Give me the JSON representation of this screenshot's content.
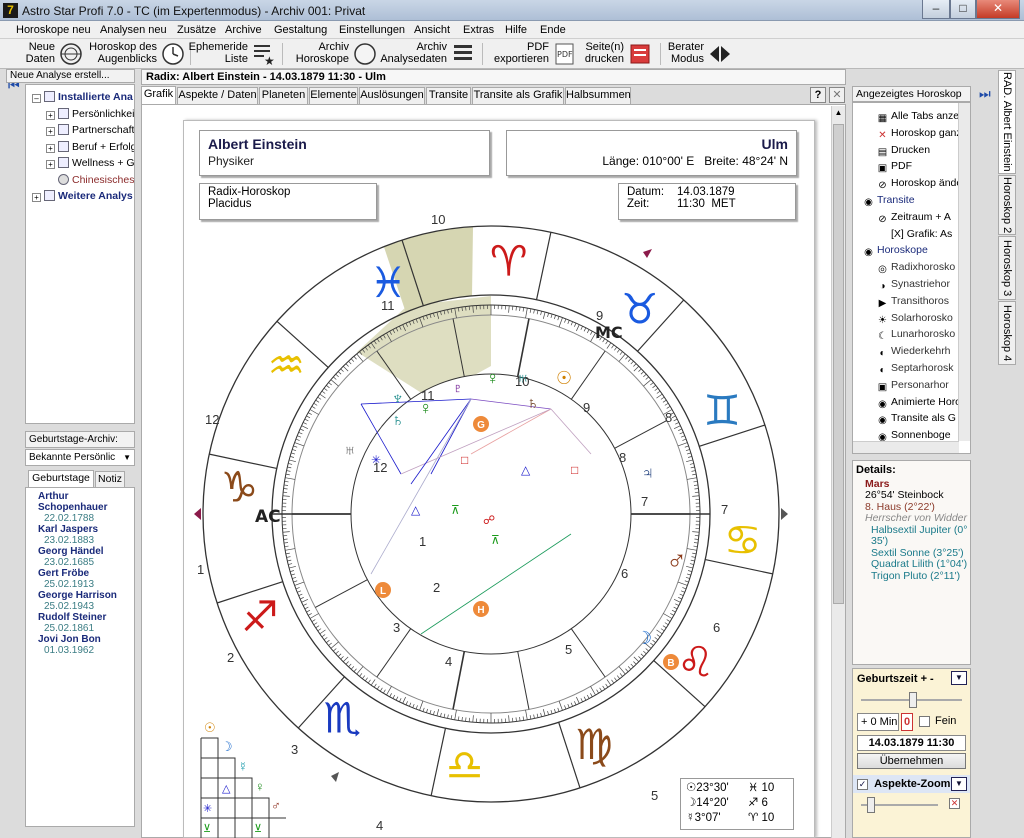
{
  "window": {
    "title": "Astro Star Profi 7.0 - TC (im Expertenmodus) - Archiv 001: Privat",
    "app_icon": "7",
    "minimize": "–",
    "maximize": "□",
    "close": "✕"
  },
  "menu": [
    "Horoskope neu",
    "Analysen neu",
    "Zusätze",
    "Archive",
    "Gestaltung",
    "Einstellungen",
    "Ansicht",
    "Extras",
    "Hilfe",
    "Ende"
  ],
  "toolbar": {
    "neue_daten": "Neue\nDaten",
    "horoskop_augenblick": "Horoskop des\nAugenblicks",
    "ephemeride": "Ephemeride\nListe",
    "archiv_horoskope": "Archiv\nHoroskope",
    "archiv_analysedaten": "Archiv\nAnalysedaten",
    "pdf": "PDF\nexportieren",
    "drucken": "Seite(n)\ndrucken",
    "berater": "Berater\nModus"
  },
  "left": {
    "header": "Neue Analyse erstell...",
    "tree": [
      {
        "label": "Installierte Ana",
        "bold": true,
        "pm": "–"
      },
      {
        "label": "Persönlichkeit",
        "pm": "+"
      },
      {
        "label": "Partnerschaft",
        "pm": "+"
      },
      {
        "label": "Beruf + Erfolg",
        "pm": "+"
      },
      {
        "label": "Wellness + Ge",
        "pm": "+"
      },
      {
        "label": "Chinesisches",
        "pm": ""
      },
      {
        "label": "Weitere Analys",
        "bold": true,
        "pm": "+"
      }
    ],
    "archive_label": "Geburtstage-Archiv:",
    "archive_select": "Bekannte Persönlic",
    "tab1": "Geburtstage",
    "tab2": "Notiz",
    "birthdays": [
      {
        "name": "Arthur\nSchopenhauer",
        "date": "22.02.1788"
      },
      {
        "name": "Karl Jaspers",
        "date": "23.02.1883"
      },
      {
        "name": "Georg Händel",
        "date": "23.02.1685"
      },
      {
        "name": "Gert Fröbe",
        "date": "25.02.1913"
      },
      {
        "name": "George Harrison",
        "date": "25.02.1943"
      },
      {
        "name": "Rudolf Steiner",
        "date": "25.02.1861"
      },
      {
        "name": "Jovi Jon Bon",
        "date": "01.03.1962"
      }
    ]
  },
  "main": {
    "header": "Radix: Albert Einstein - 14.03.1879 11:30 - Ulm",
    "tabs": [
      "Grafik",
      "Aspekte / Daten",
      "Planeten",
      "Elemente",
      "Auslösungen",
      "Transite",
      "Transite als Grafik",
      "Halbsummen"
    ],
    "help": "?",
    "close": "✕"
  },
  "chart": {
    "name": "Albert Einstein",
    "profession": "Physiker",
    "place": "Ulm",
    "coords": "Länge: 010°00' E   Breite: 48°24' N",
    "type": "Radix-Horoskop",
    "system": "Placidus",
    "datum_label": "Datum:",
    "datum": "14.03.1879",
    "zeit_label": "Zeit:",
    "zeit": "11:30  MET",
    "ac": "AC",
    "mc": "MC",
    "house_numbers": [
      "1",
      "2",
      "3",
      "4",
      "5",
      "6",
      "7",
      "8",
      "9",
      "10",
      "11",
      "12"
    ],
    "inner_house_numbers": [
      "1",
      "2",
      "3",
      "4",
      "5",
      "6",
      "7",
      "8",
      "9",
      "10",
      "11",
      "12"
    ],
    "legend": [
      {
        "sym": "☉",
        "val": "23°30'",
        "sym2": "♓",
        "val2": "10"
      },
      {
        "sym": "☽",
        "val": "14°20'",
        "sym2": "♐",
        "val2": "6"
      },
      {
        "sym": "☿",
        "val": "3°07'",
        "sym2": "♈",
        "val2": "10"
      }
    ]
  },
  "right": {
    "header": "Angezeigtes Horoskop",
    "items": [
      {
        "icon": "▦",
        "label": "Alle Tabs anzei"
      },
      {
        "icon": "✕",
        "label": "Horoskop ganz"
      },
      {
        "icon": "▤",
        "label": "Drucken"
      },
      {
        "icon": "▣",
        "label": "PDF"
      },
      {
        "icon": "⊘",
        "label": "Horoskop ände"
      },
      {
        "icon": "◉",
        "label": "Transite",
        "bold": true
      },
      {
        "icon": "⊘",
        "label": "Zeitraum + A"
      },
      {
        "icon": "",
        "label": "[X] Grafik: As"
      },
      {
        "icon": "◉",
        "label": "Horoskope",
        "bold": true
      },
      {
        "icon": "◎",
        "label": "Radixhorosko"
      },
      {
        "icon": "◑",
        "label": "Synastriehor"
      },
      {
        "icon": "▶",
        "label": "Transithoros"
      },
      {
        "icon": "☀",
        "label": "Solarhorosko"
      },
      {
        "icon": "☾",
        "label": "Lunarhorosko"
      },
      {
        "icon": "◐",
        "label": "Wiederkehrh"
      },
      {
        "icon": "◐",
        "label": "Septarhorosk"
      },
      {
        "icon": "▣",
        "label": "Personarhor"
      },
      {
        "icon": "◉",
        "label": "Animierte Horos"
      },
      {
        "icon": "◉",
        "label": "Transite als G"
      },
      {
        "icon": "◉",
        "label": "Sonnenboge"
      }
    ],
    "details_title": "Details:",
    "details": [
      {
        "t": "Mars",
        "c": "#8b1a1a",
        "b": true
      },
      {
        "t": "26°54' Steinbock",
        "c": "#000"
      },
      {
        "t": "8. Haus (2°22')",
        "c": "#8b3a2a"
      },
      {
        "t": "Herrscher von Widder",
        "c": "#888",
        "i": true
      },
      {
        "t": "Halbsextil Jupiter (0°",
        "c": "#1a7a8a"
      },
      {
        "t": "35')",
        "c": "#1a7a8a"
      },
      {
        "t": "Sextil Sonne (3°25')",
        "c": "#1a7a8a"
      },
      {
        "t": "Quadrat Lilith (1°04')",
        "c": "#1a7a8a"
      },
      {
        "t": "Trigon Pluto (2°11')",
        "c": "#1a7a8a"
      }
    ],
    "gz_title": "Geburtszeit + -",
    "gz_min": "+ 0 Min",
    "gz_zero": "0",
    "gz_fein": "Fein",
    "gz_date": "14.03.1879 11:30",
    "gz_apply": "Übernehmen",
    "az_title": "Aspekte-Zoom"
  },
  "vtabs": [
    "RAD. Albert Einstein",
    "Horoskop 2",
    "Horoskop 3",
    "Horoskop 4"
  ],
  "colors": {
    "accent": "#2a4a9a",
    "ok": "#1a8a1a",
    "mars": "#8b3a1a"
  }
}
